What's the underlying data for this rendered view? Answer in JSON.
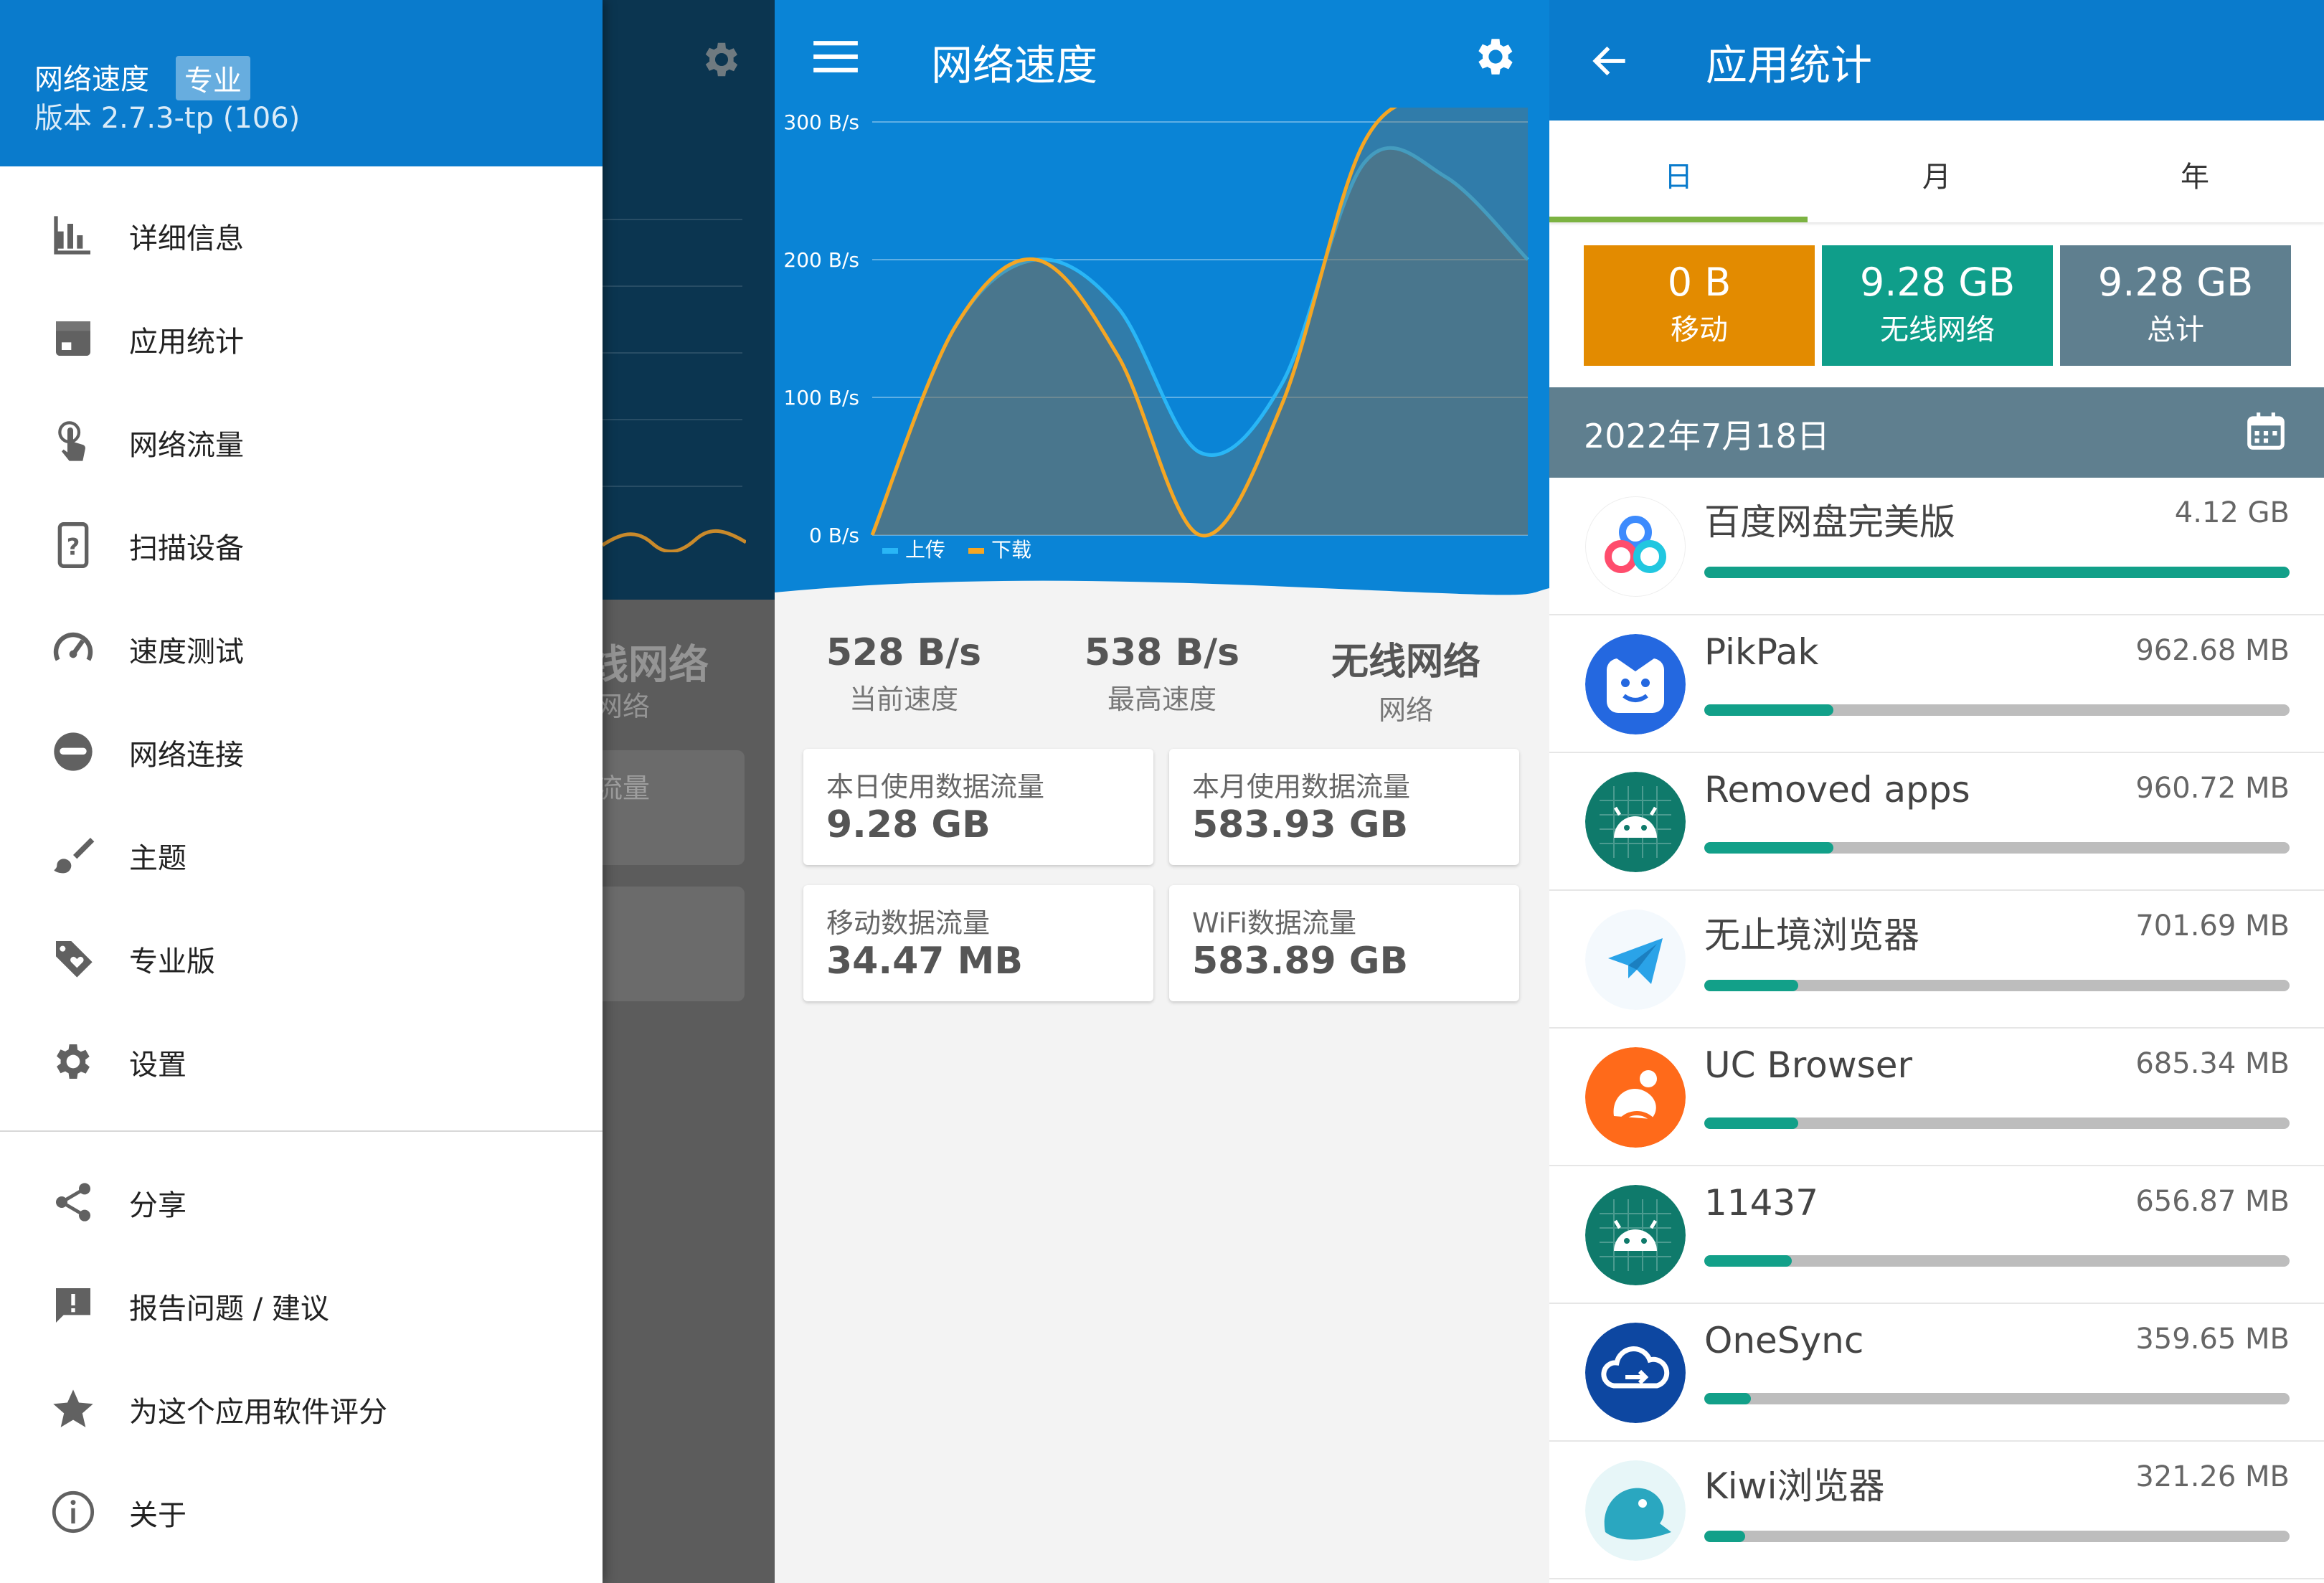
{
  "drawer": {
    "app_name": "网络速度",
    "pro_badge": "专业",
    "version": "版本 2.7.3-tp (106)",
    "items": [
      {
        "label": "详细信息",
        "icon": "bar-chart-icon"
      },
      {
        "label": "应用统计",
        "icon": "app-stats-icon"
      },
      {
        "label": "网络流量",
        "icon": "touch-icon"
      },
      {
        "label": "扫描设备",
        "icon": "device-question-icon"
      },
      {
        "label": "速度测试",
        "icon": "speedometer-icon"
      },
      {
        "label": "网络连接",
        "icon": "incognito-icon"
      },
      {
        "label": "主题",
        "icon": "brush-icon"
      },
      {
        "label": "专业版",
        "icon": "tag-heart-icon"
      },
      {
        "label": "设置",
        "icon": "gear-icon"
      }
    ],
    "secondary_items": [
      {
        "label": "分享",
        "icon": "share-icon"
      },
      {
        "label": "报告问题 / 建议",
        "icon": "feedback-icon"
      },
      {
        "label": "为这个应用软件评分",
        "icon": "star-icon"
      },
      {
        "label": "关于",
        "icon": "info-icon"
      }
    ]
  },
  "behind": {
    "network_name": "线网络",
    "network_sub": "网络",
    "card_label": "流量"
  },
  "speed": {
    "title": "网络速度",
    "stats": [
      {
        "value": "528 B/s",
        "label": "当前速度"
      },
      {
        "value": "538 B/s",
        "label": "最高速度"
      },
      {
        "value": "无线网络",
        "label": "网络"
      }
    ],
    "cards": [
      {
        "label": "本日使用数据流量",
        "value": "9.28 GB"
      },
      {
        "label": "本月使用数据流量",
        "value": "583.93 GB"
      },
      {
        "label": "移动数据流量",
        "value": "34.47 MB"
      },
      {
        "label": "WiFi数据流量",
        "value": "583.89 GB"
      }
    ]
  },
  "chart_data": {
    "type": "area",
    "y_ticks": [
      "0 B/s",
      "100 B/s",
      "200 B/s",
      "300 B/s"
    ],
    "ylim": [
      0,
      300
    ],
    "legend_position": "bottom-left",
    "series": [
      {
        "name": "上传",
        "color": "#29b6f6",
        "values": [
          0,
          150,
          200,
          165,
          60,
          110,
          270,
          260,
          200
        ]
      },
      {
        "name": "下载",
        "color": "#f5a623",
        "values": [
          0,
          150,
          200,
          130,
          0,
          95,
          285,
          320,
          325
        ]
      }
    ]
  },
  "stats": {
    "title": "应用统计",
    "tabs": [
      "日",
      "月",
      "年"
    ],
    "active_tab": 0,
    "summary": [
      {
        "value": "0 B",
        "label": "移动",
        "color": "#e38b00"
      },
      {
        "value": "9.28 GB",
        "label": "无线网络",
        "color": "#0f9e8a"
      },
      {
        "value": "9.28 GB",
        "label": "总计",
        "color": "#5f7f8f"
      }
    ],
    "date": "2022年7月18日",
    "apps": [
      {
        "name": "百度网盘完美版",
        "size": "4.12 GB",
        "fraction": 1.0,
        "icon": "baidu-netdisk-icon"
      },
      {
        "name": "PikPak",
        "size": "962.68 MB",
        "fraction": 0.22,
        "icon": "pikpak-icon"
      },
      {
        "name": "Removed apps",
        "size": "960.72 MB",
        "fraction": 0.22,
        "icon": "android-icon"
      },
      {
        "name": "无止境浏览器",
        "size": "701.69 MB",
        "fraction": 0.16,
        "icon": "paper-plane-icon"
      },
      {
        "name": "UC Browser",
        "size": "685.34 MB",
        "fraction": 0.16,
        "icon": "uc-browser-icon"
      },
      {
        "name": "11437",
        "size": "656.87 MB",
        "fraction": 0.15,
        "icon": "android-icon"
      },
      {
        "name": "OneSync",
        "size": "359.65 MB",
        "fraction": 0.08,
        "icon": "cloud-sync-icon"
      },
      {
        "name": "Kiwi浏览器",
        "size": "321.26 MB",
        "fraction": 0.07,
        "icon": "kiwi-bird-icon"
      }
    ]
  }
}
